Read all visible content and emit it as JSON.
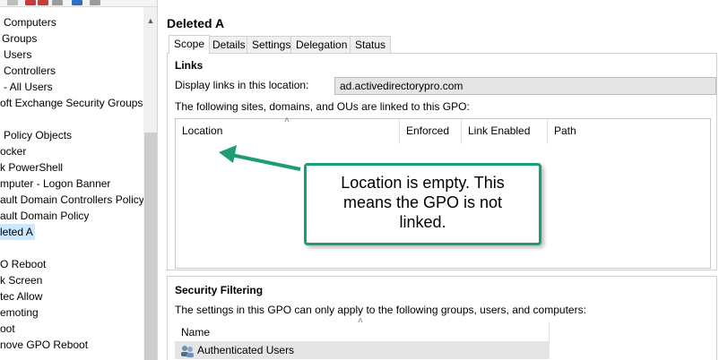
{
  "tree": {
    "items": [
      {
        "label": "Computers"
      },
      {
        "label": "Groups"
      },
      {
        "label": "Users"
      },
      {
        "label": "Controllers"
      },
      {
        "label": "- All Users"
      },
      {
        "label": "oft Exchange Security Groups"
      },
      {
        "label": ""
      },
      {
        "label": "Policy Objects"
      },
      {
        "label": "ocker"
      },
      {
        "label": "k PowerShell"
      },
      {
        "label": "mputer - Logon Banner"
      },
      {
        "label": "ault Domain Controllers Policy"
      },
      {
        "label": "ault Domain Policy"
      },
      {
        "label": "leted A"
      },
      {
        "label": ""
      },
      {
        "label": "O Reboot"
      },
      {
        "label": "k Screen"
      },
      {
        "label": "tec Allow"
      },
      {
        "label": "emoting"
      },
      {
        "label": "oot"
      },
      {
        "label": "nove GPO Reboot"
      }
    ],
    "selected_index": 13
  },
  "gpo": {
    "title": "Deleted A"
  },
  "tabs": [
    {
      "label": "Scope"
    },
    {
      "label": "Details"
    },
    {
      "label": "Settings"
    },
    {
      "label": "Delegation"
    },
    {
      "label": "Status"
    }
  ],
  "links": {
    "heading": "Links",
    "display_label": "Display links in this location:",
    "location_value": "ad.activedirectorypro.com",
    "linked_label": "The following sites, domains, and OUs are linked to this GPO:",
    "columns": [
      "Location",
      "Enforced",
      "Link Enabled",
      "Path"
    ]
  },
  "callout": {
    "text": "Location is empty. This means the GPO is not linked.",
    "color": "#1e9c72"
  },
  "security": {
    "heading": "Security Filtering",
    "description": "The settings in this GPO can only apply to the following groups, users, and computers:",
    "column": "Name",
    "rows": [
      "Authenticated Users"
    ]
  },
  "icons": {
    "sort": "˄",
    "scroll_up": "▲"
  }
}
